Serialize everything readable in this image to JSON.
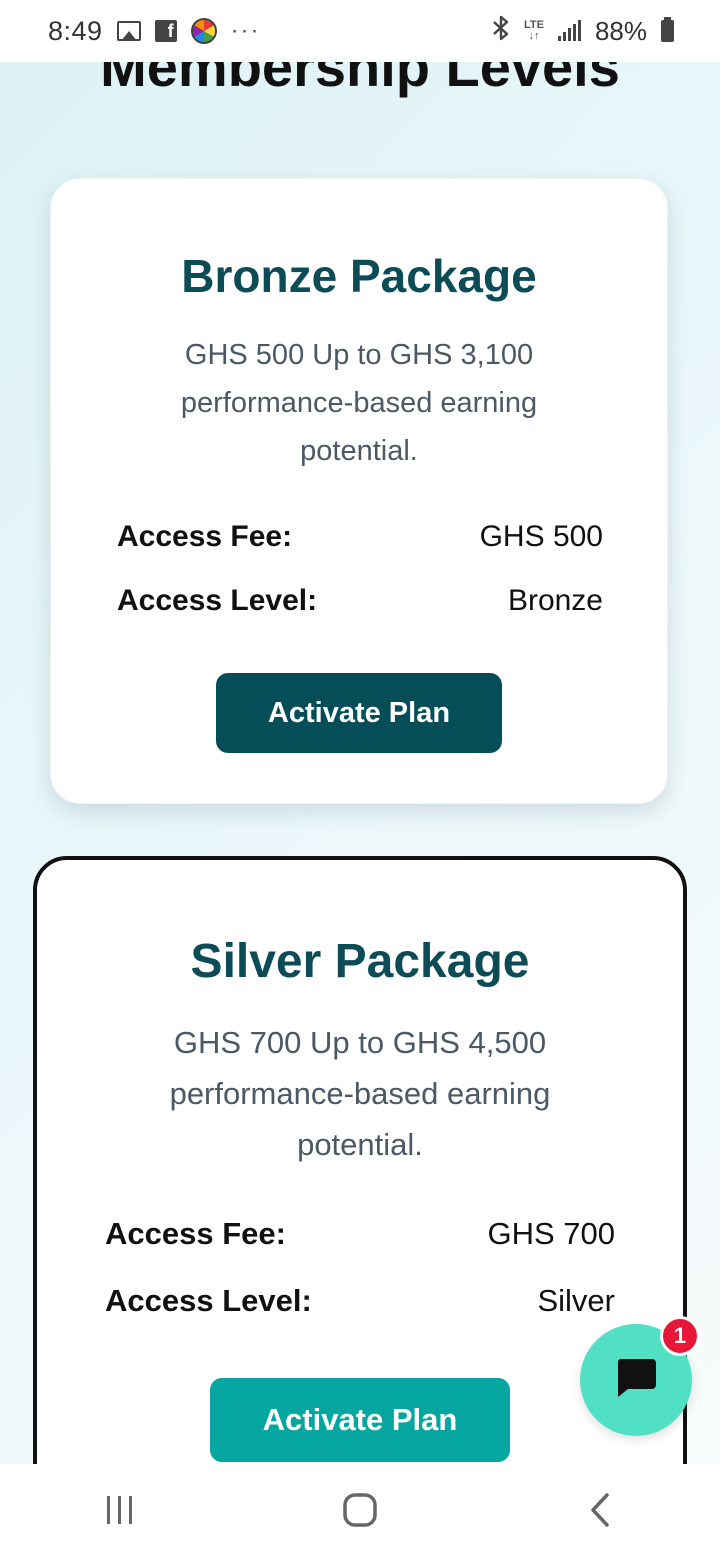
{
  "status_bar": {
    "time": "8:49",
    "more": "···",
    "network": "LTE",
    "battery": "88%"
  },
  "page": {
    "section_title": "Membership Levels"
  },
  "cards": [
    {
      "title": "Bronze Package",
      "description": "GHS 500 Up to GHS 3,100 performance-based earning potential.",
      "fee_label": "Access Fee:",
      "fee_value": "GHS 500",
      "level_label": "Access Level:",
      "level_value": "Bronze",
      "button_label": "Activate Plan",
      "button_color": "#054d57"
    },
    {
      "title": "Silver Package",
      "description": "GHS 700 Up to GHS 4,500 performance-based earning potential.",
      "fee_label": "Access Fee:",
      "fee_value": "GHS 700",
      "level_label": "Access Level:",
      "level_value": "Silver",
      "button_label": "Activate Plan",
      "button_color": "#05a69f"
    }
  ],
  "chat": {
    "icon": "chat-bubble-icon",
    "badge_count": "1",
    "color": "#52e0c4"
  },
  "nav": {
    "recents_icon": "recents-icon",
    "home_icon": "home-icon",
    "back_icon": "back-icon"
  }
}
